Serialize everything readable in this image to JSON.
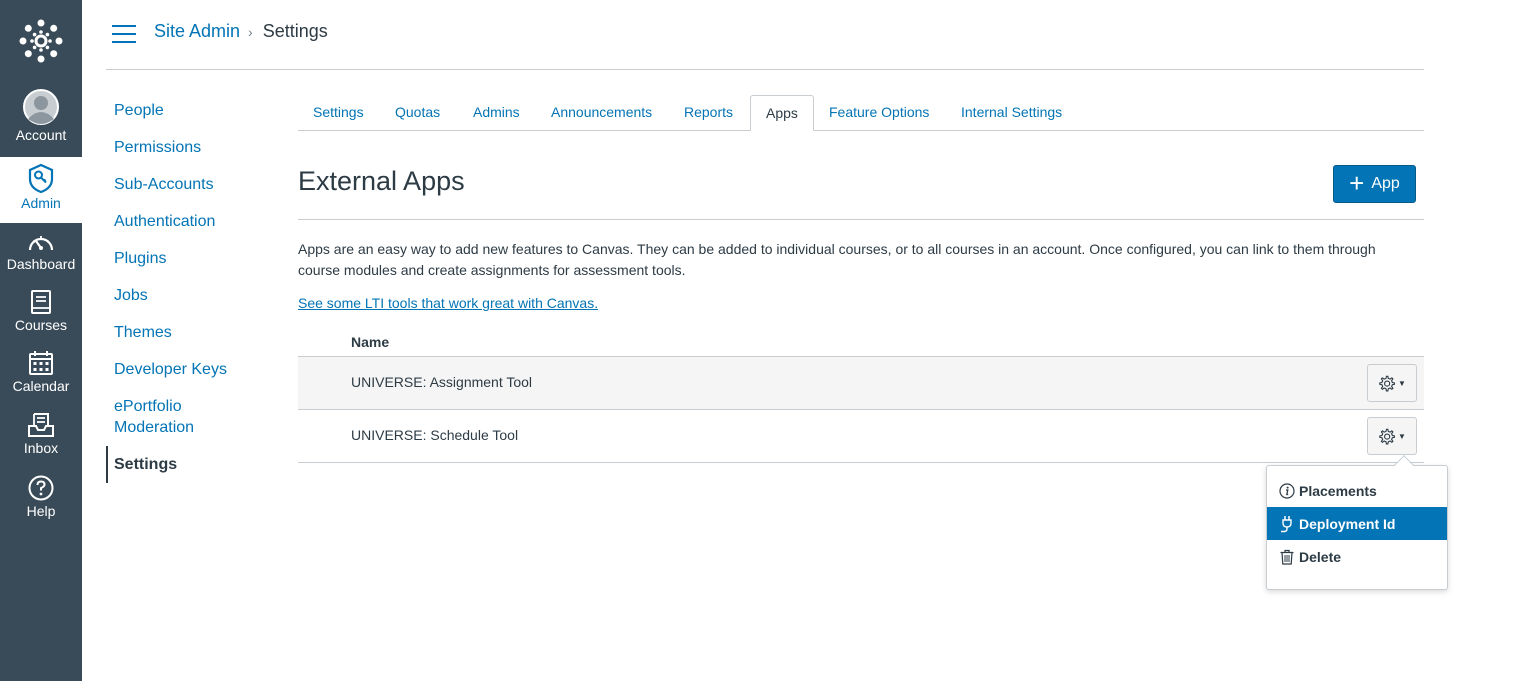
{
  "global_nav": {
    "items": [
      {
        "label": "Account",
        "icon": "avatar-icon"
      },
      {
        "label": "Admin",
        "icon": "admin-shield-icon"
      },
      {
        "label": "Dashboard",
        "icon": "dashboard-icon"
      },
      {
        "label": "Courses",
        "icon": "courses-book-icon"
      },
      {
        "label": "Calendar",
        "icon": "calendar-icon"
      },
      {
        "label": "Inbox",
        "icon": "inbox-icon"
      },
      {
        "label": "Help",
        "icon": "help-icon"
      }
    ],
    "active": "Admin",
    "colors": {
      "bg": "#394b58",
      "accent": "#0374b5"
    }
  },
  "breadcrumb": {
    "root": "Site Admin",
    "current": "Settings"
  },
  "subnav": {
    "items": [
      "People",
      "Permissions",
      "Sub-Accounts",
      "Authentication",
      "Plugins",
      "Jobs",
      "Themes",
      "Developer Keys",
      "ePortfolio Moderation",
      "Settings"
    ],
    "active": "Settings"
  },
  "tabs": {
    "items": [
      "Settings",
      "Quotas",
      "Admins",
      "Announcements",
      "Reports",
      "Apps",
      "Feature Options",
      "Internal Settings"
    ],
    "active": "Apps"
  },
  "main": {
    "title": "External Apps",
    "add_button_label": "App",
    "description": "Apps are an easy way to add new features to Canvas. They can be added to individual courses, or to all courses in an account. Once configured, you can link to them through course modules and create assignments for assessment tools.",
    "lti_link": "See some LTI tools that work great with Canvas."
  },
  "table": {
    "column_header": "Name",
    "rows": [
      "UNIVERSE: Assignment Tool",
      "UNIVERSE: Schedule Tool"
    ]
  },
  "gear_menu": {
    "items": [
      {
        "label": "Placements",
        "icon": "info-icon"
      },
      {
        "label": "Deployment Id",
        "icon": "plug-icon"
      },
      {
        "label": "Delete",
        "icon": "trash-icon"
      }
    ],
    "highlighted": "Deployment Id"
  }
}
